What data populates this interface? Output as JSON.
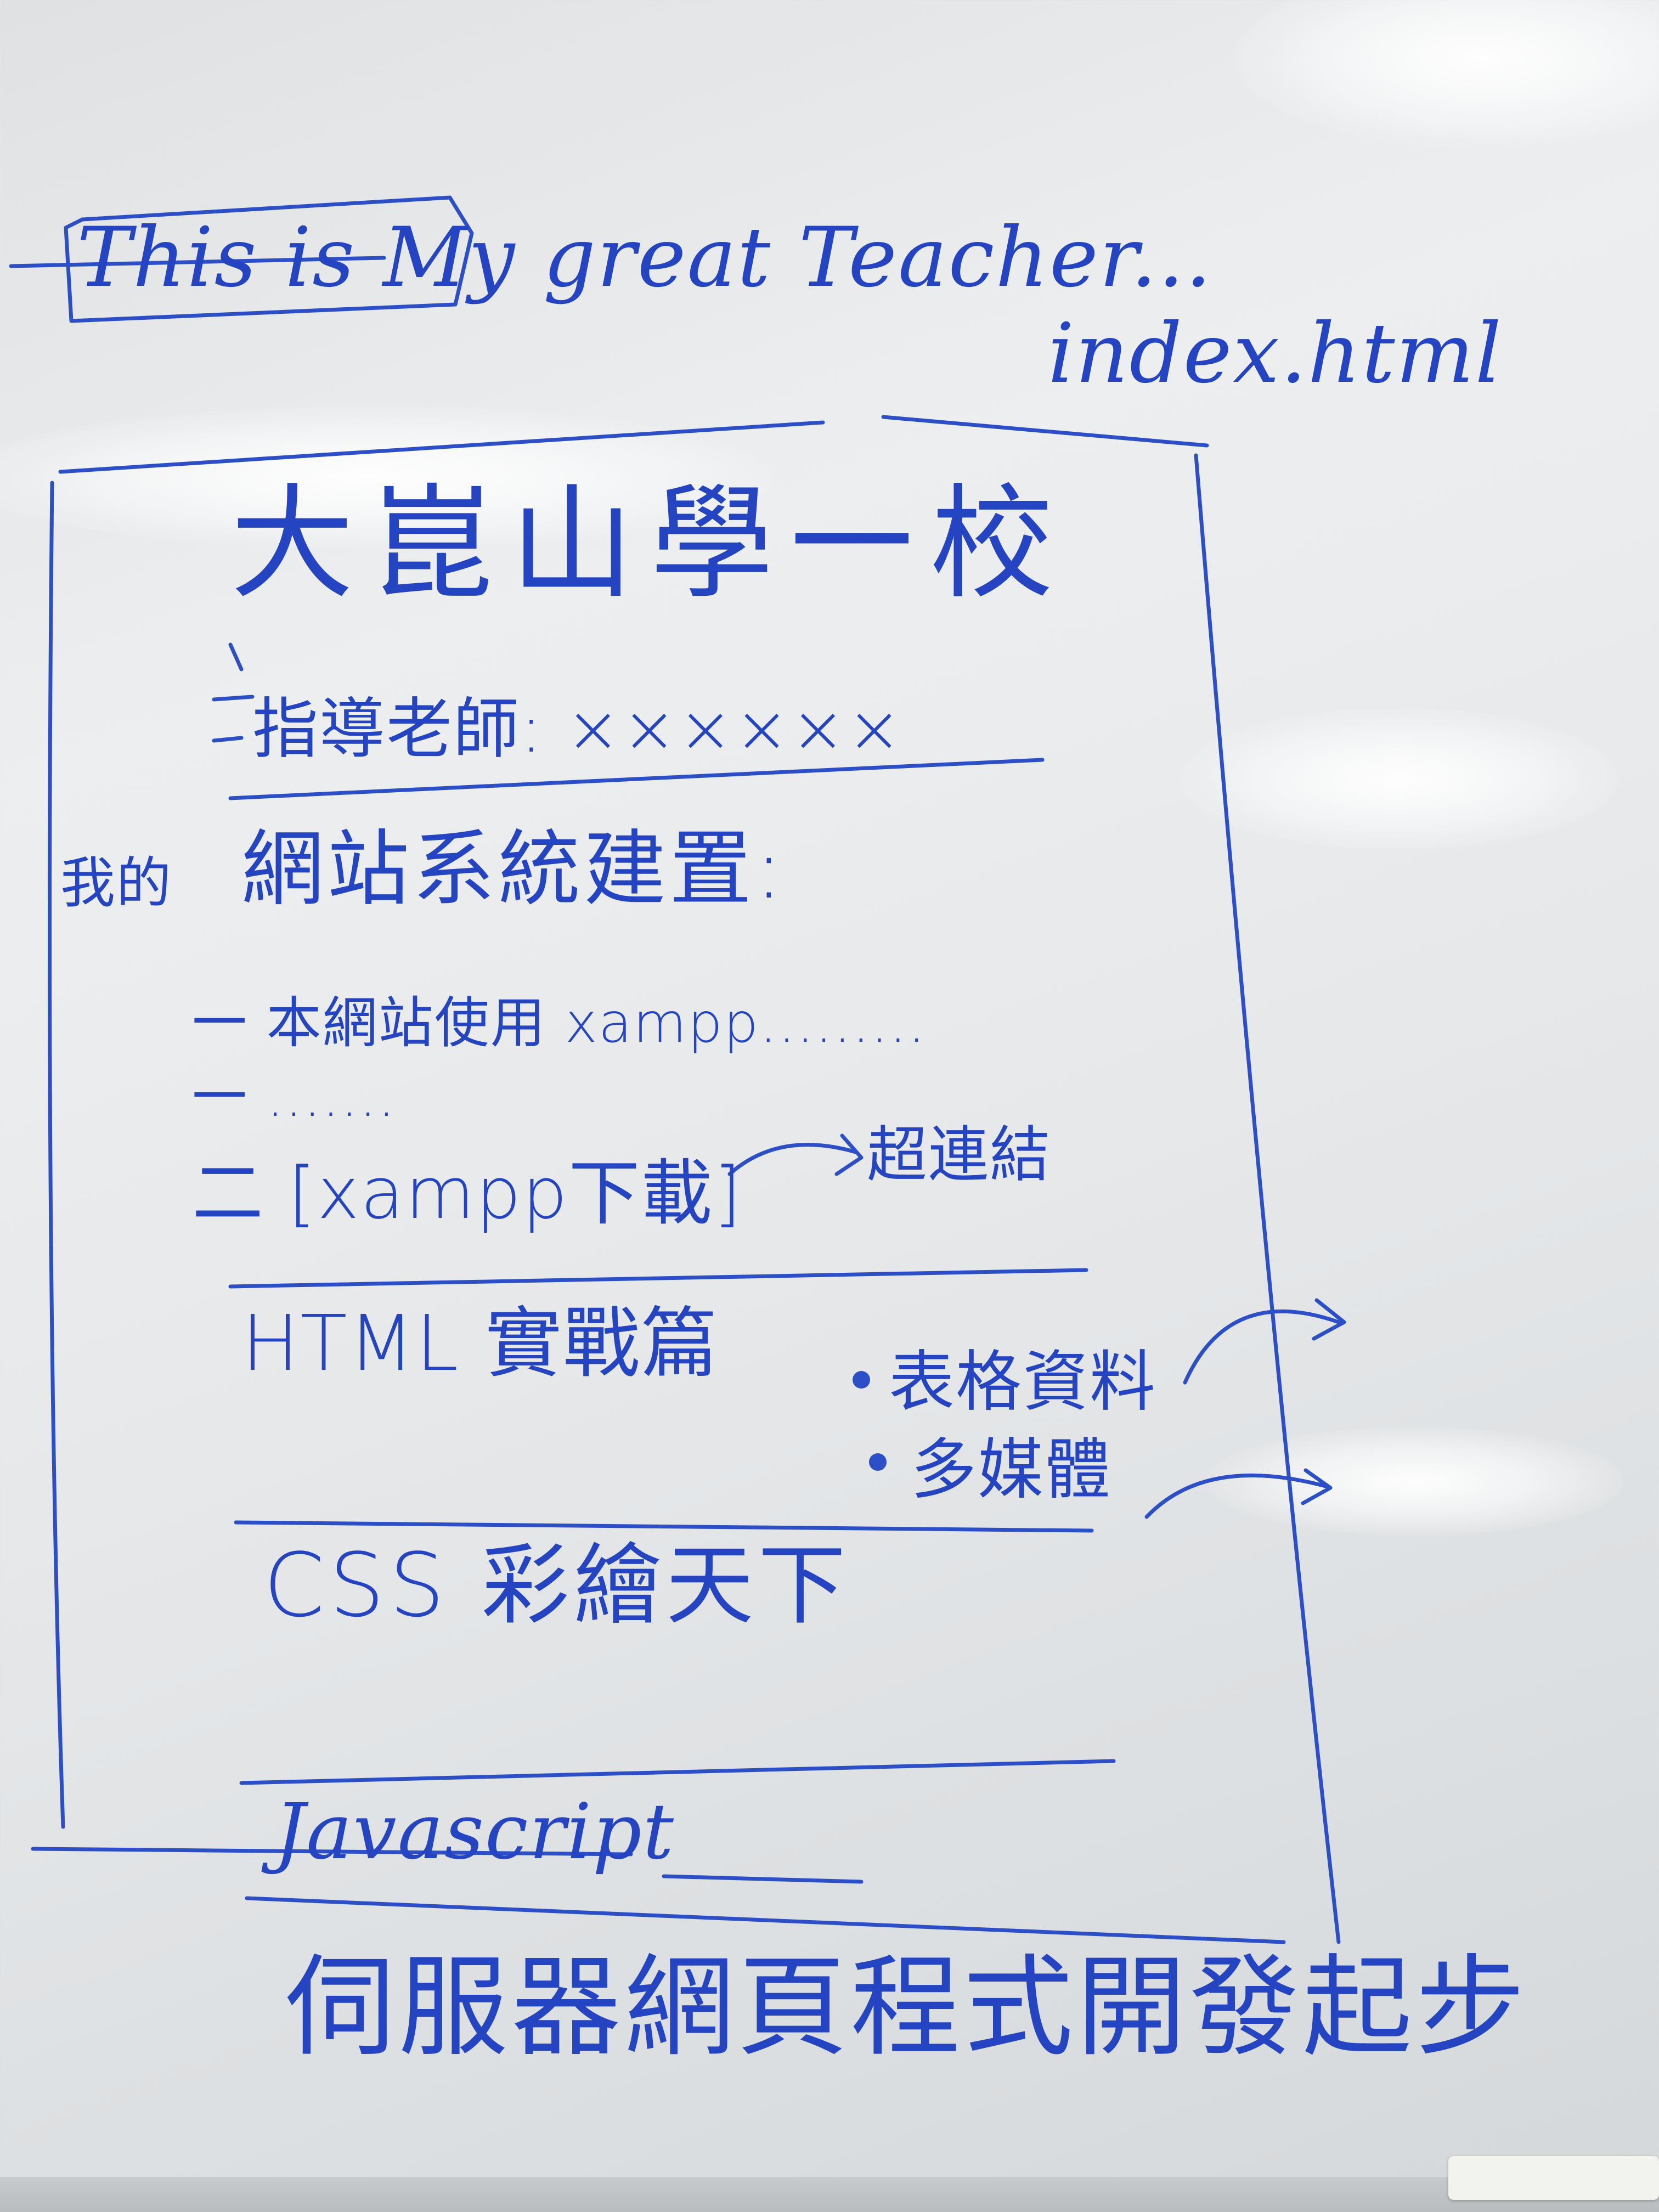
{
  "header_note": "This is My great Teacher...",
  "filename": "index.html",
  "page": {
    "title": "大崑山學一校",
    "instructor": "指導老師: ××××××",
    "side_label": "我的",
    "section_title": "網站系統建置:",
    "items": [
      "一 本網站使用 xampp.........",
      "一 .......",
      "二 [xampp下載]"
    ],
    "link_note": "超連結",
    "html_section": "HTML 實戰篇",
    "html_bullets": [
      "表格資料",
      "多媒體"
    ],
    "css_section": "CSS 彩繪天下",
    "js_section": "Javascript"
  },
  "footer_caption": "伺服器網頁程式開發起步",
  "colors": {
    "board": "#e6e8ea",
    "ink": "#2444c2"
  }
}
